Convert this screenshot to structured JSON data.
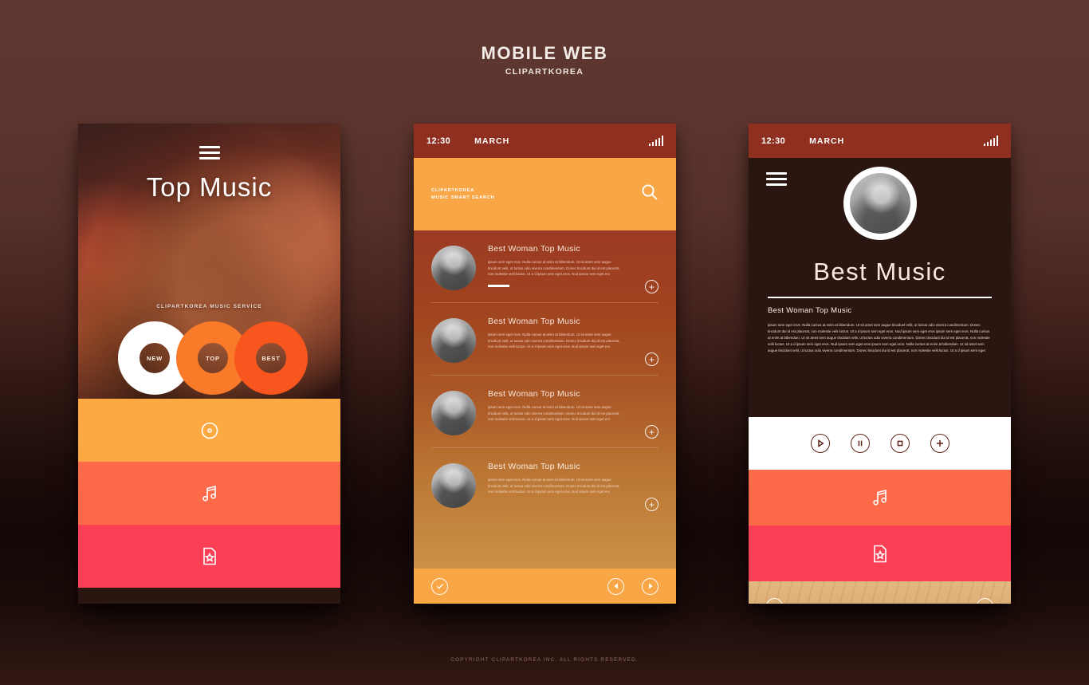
{
  "page": {
    "title": "MOBILE WEB",
    "subtitle": "CLIPARTKOREA",
    "copyright": "COPYRIGHT CLIPARTKOREA INC. ALL RIGHTS RESERVED."
  },
  "colors": {
    "background_top": "#5e3831",
    "background_bottom": "#331913",
    "statusbar": "#8f2f20",
    "amber": "#fba940",
    "coral": "#fc6a4a",
    "red": "#fb4055",
    "search_header": "#f9a746",
    "ring_new": "#ffffff",
    "ring_top": "#f97a28",
    "ring_best": "#f9551f",
    "control_outline": "#5c241a",
    "wood": "#dcae74"
  },
  "screen1": {
    "menu_icon": "hamburger-menu-icon",
    "title": "Top Music",
    "caption": "CLIPARTKOREA MUSIC SERVICE",
    "rings": [
      {
        "label": "NEW",
        "color": "#ffffff"
      },
      {
        "label": "TOP",
        "color": "#f97a28"
      },
      {
        "label": "BEST",
        "color": "#f9551f"
      }
    ],
    "bands": [
      {
        "icon": "disc-icon",
        "color": "#fba940"
      },
      {
        "icon": "music-note-icon",
        "color": "#fc6a4a"
      },
      {
        "icon": "document-star-icon",
        "color": "#fb4055"
      }
    ]
  },
  "screen2": {
    "statusbar": {
      "time": "12:30",
      "month": "MARCH",
      "signal_icon": "signal-bars-icon"
    },
    "search": {
      "line1": "CLIPARTKOREA",
      "line2": "MUSIC SMART SEARCH",
      "icon": "search-icon"
    },
    "list": [
      {
        "title": "Best Woman Top Music",
        "body": "ipsum sem eget eros. Nulla cursus at enim at bibendum. Ut sit amet sem augue tincidunt velit, ut luctus odio viverra condimentum. Donec tincidunt dui id est placerat, non molestie velit luctus. Ut a d ipsum sem eget eros. Nud ipsum sem eget ero",
        "add_label": "+",
        "has_accent": true,
        "thumb": "portrait-thumbnail"
      },
      {
        "title": "Best Woman Top Music",
        "body": "ipsum sem eget eros. Nulla cursus at enim at bibendum. Ut sit amet sem augue tincidunt velit, ut luctus odio viverra condimentum. Donec tincidunt dui id est placerat, non molestie velit luctus. Ut a d ipsum sem eget eros. Nud ipsum sem eget ero",
        "add_label": "+",
        "has_accent": false,
        "thumb": "music-note-thumbnail"
      },
      {
        "title": "Best Woman Top Music",
        "body": "ipsum sem eget eros. Nulla cursus at enim at bibendum. Ut sit amet sem augue tincidunt velit, ut luctus odio viverra condimentum. Donec tincidunt dui id est placerat, non molestie velit luctus. Ut a d ipsum sem eget eros. Nud ipsum sem eget ero",
        "add_label": "+",
        "has_accent": false,
        "thumb": "portrait-cap-thumbnail"
      },
      {
        "title": "Best Woman Top Music",
        "body": "ipsum sem eget eros. Nulla cursus at enim at bibendum. Ut sit amet sem augue tincidunt velit, ut luctus odio viverra condimentum. Donec tincidunt dui id est placerat, non molestie velit luctus. Ut a d ipsum sem eget eros. Nud ipsum sem eget ero",
        "add_label": "+",
        "has_accent": false,
        "thumb": "portrait-bag-thumbnail"
      }
    ],
    "navbar": [
      {
        "icon": "check-circle-icon"
      },
      {
        "icon": "previous-circle-icon"
      },
      {
        "icon": "next-circle-icon"
      }
    ]
  },
  "screen3": {
    "statusbar": {
      "time": "12:30",
      "month": "MARCH",
      "signal_icon": "signal-bars-icon"
    },
    "menu_icon": "hamburger-menu-icon",
    "avatar": "profile-avatar",
    "title": "Best Music",
    "subtitle": "Best Woman Top Music",
    "body": "ipsum sem eget eros. Nulla cursus at enim at bibendum. Ut sit amet sem augue tincidunt velit, ut luctus odio viverra condimentum. Donec tincidunt dui id est placerat, non molestie velit luctus. Ut a d ipsum sem eget eros. Nud ipsum sem eget eros ipsum sem eget eros. Nulla cursus at enim at bibendum. Ut sit amet sem augue tincidunt velit, ut luctus odio viverra condimentum. Donec tincidunt dui id est placerat, non molestie velit luctus. Ut a d ipsum sem eget eros. Nud ipsum sem eget eros ipsum sem eget eros. Nulla cursus at enim at bibendum. Ut sit amet sem augue tincidunt velit, ut luctus odio viverra condimentum. Donec tincidunt dui id est placerat, non molestie velit luctus. Ut a d ipsum sem eget",
    "controls": [
      {
        "icon": "play-icon"
      },
      {
        "icon": "pause-icon"
      },
      {
        "icon": "stop-icon"
      },
      {
        "icon": "add-icon"
      }
    ],
    "bands": [
      {
        "icon": "music-note-icon",
        "color": "#fc6a4a"
      },
      {
        "icon": "document-star-icon",
        "color": "#fb4055"
      }
    ],
    "footer_nav": [
      {
        "icon": "previous-circle-icon"
      },
      {
        "icon": "next-circle-icon"
      }
    ]
  }
}
